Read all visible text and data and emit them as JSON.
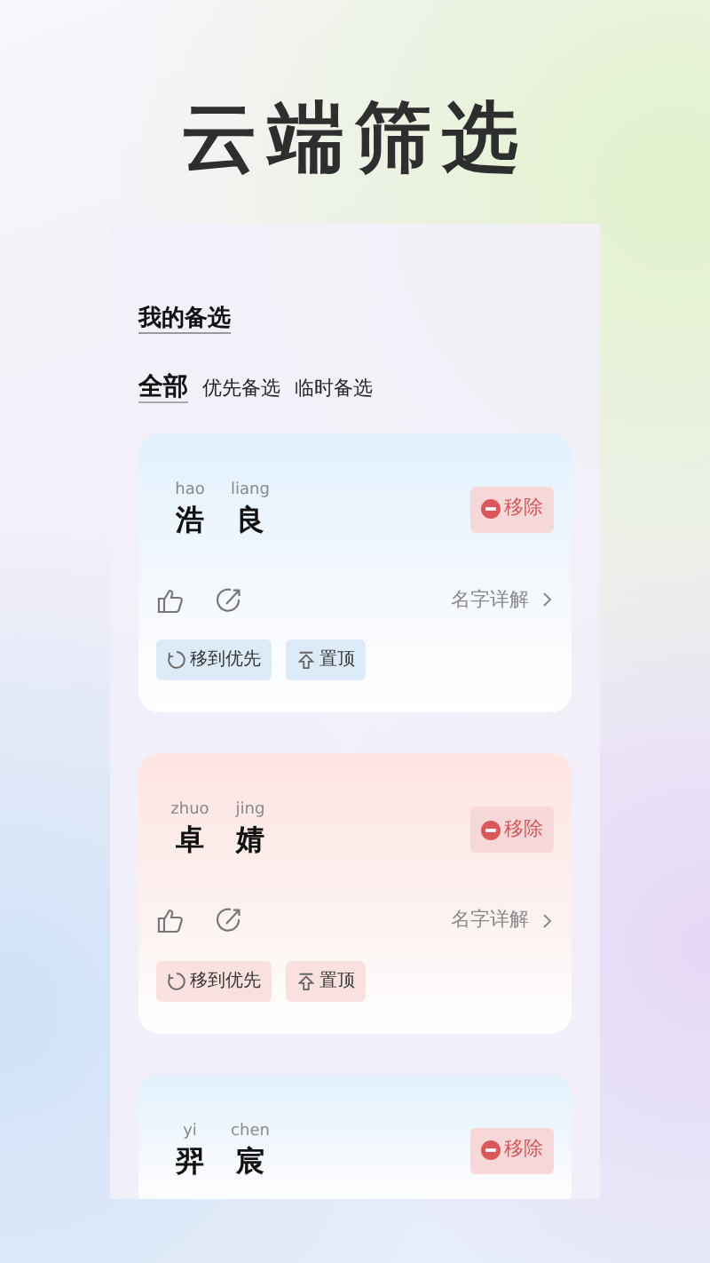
{
  "headline": "云端筛选",
  "page_title": "我的备选",
  "tabs": [
    {
      "label": "全部",
      "selected": true
    },
    {
      "label": "优先备选",
      "selected": false
    },
    {
      "label": "临时备选",
      "selected": false
    }
  ],
  "cards": [
    {
      "kind": "blue",
      "chars": [
        {
          "pinyin": "hao",
          "char": "浩"
        },
        {
          "pinyin": "liang",
          "char": "良"
        }
      ],
      "remove": "移除",
      "detail": "名字详解",
      "actions": [
        "移到优先",
        "置顶"
      ]
    },
    {
      "kind": "pink",
      "chars": [
        {
          "pinyin": "zhuo",
          "char": "卓"
        },
        {
          "pinyin": "jing",
          "char": "婧"
        }
      ],
      "remove": "移除",
      "detail": "名字详解",
      "actions": [
        "移到优先",
        "置顶"
      ]
    },
    {
      "kind": "blue",
      "chars": [
        {
          "pinyin": "yi",
          "char": "羿"
        },
        {
          "pinyin": "chen",
          "char": "宸"
        }
      ],
      "remove": "移除"
    }
  ]
}
